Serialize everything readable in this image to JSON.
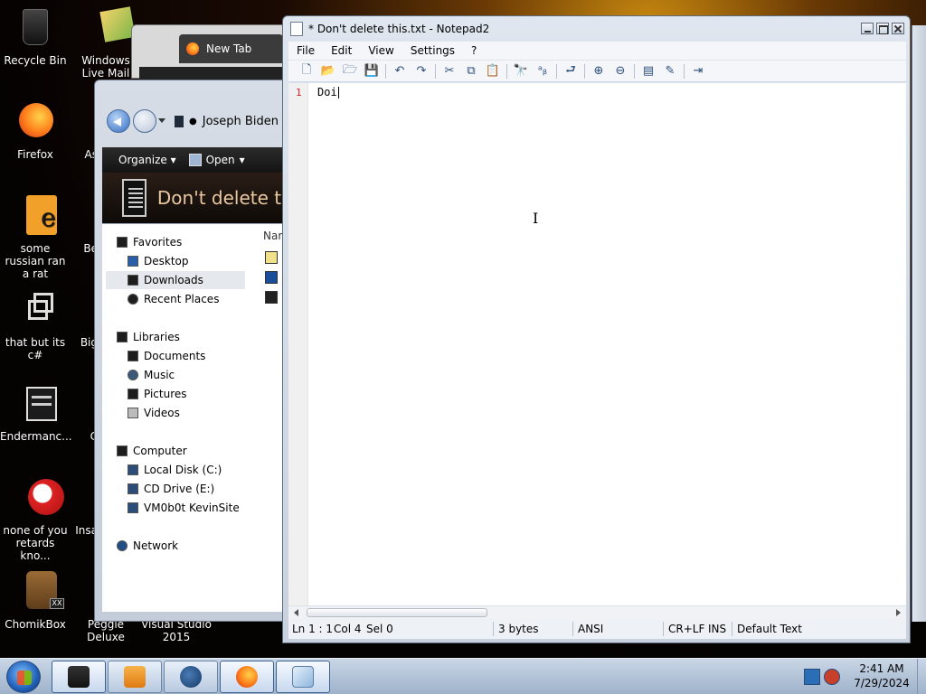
{
  "desktop": {
    "icons": [
      {
        "label": "Recycle Bin"
      },
      {
        "label": "Windows Live Mail"
      },
      {
        "label": "Firefox"
      },
      {
        "label": "As"
      },
      {
        "label": "some russian ran a rat"
      },
      {
        "label": "Be"
      },
      {
        "label": "that but its c#"
      },
      {
        "label": "Big"
      },
      {
        "label": "Endermanc..."
      },
      {
        "label": "C"
      },
      {
        "label": "none of you retards kno..."
      },
      {
        "label": "Insa"
      },
      {
        "label": "ChomikBox"
      },
      {
        "label": "Peggle Deluxe"
      },
      {
        "label": "Visual Studio 2015"
      }
    ]
  },
  "firefox": {
    "tab_label": "New Tab"
  },
  "explorer": {
    "breadcrumb": "Joseph Biden",
    "toolbar": {
      "organize": "Organize",
      "open": "Open"
    },
    "header_title": "Don't delete this",
    "column_name": "Nam",
    "tree": {
      "favorites": "Favorites",
      "desktop": "Desktop",
      "downloads": "Downloads",
      "recent_places": "Recent Places",
      "libraries": "Libraries",
      "documents": "Documents",
      "music": "Music",
      "pictures": "Pictures",
      "videos": "Videos",
      "computer": "Computer",
      "local_disk": "Local Disk (C:)",
      "cd_drive": "CD Drive (E:)",
      "network_drive": "VM0b0t KevinSite",
      "network": "Network"
    }
  },
  "notepad": {
    "title": "* Don't delete this.txt - Notepad2",
    "menu": [
      "File",
      "Edit",
      "View",
      "Settings",
      "?"
    ],
    "line_number": "1",
    "line_text": "Doi",
    "status": {
      "position": "Ln 1 : 1",
      "column": "Col 4",
      "selection": "Sel 0",
      "size": "3 bytes",
      "encoding": "ANSI",
      "line_ending": "CR+LF",
      "mode": "INS",
      "scheme": "Default Text"
    }
  },
  "taskbar": {
    "time": "2:41 AM",
    "date": "7/29/2024"
  },
  "colors": {
    "accent": "#2f6bc2",
    "line_number": "#cc2222",
    "taskbar": "#b8c9de"
  }
}
